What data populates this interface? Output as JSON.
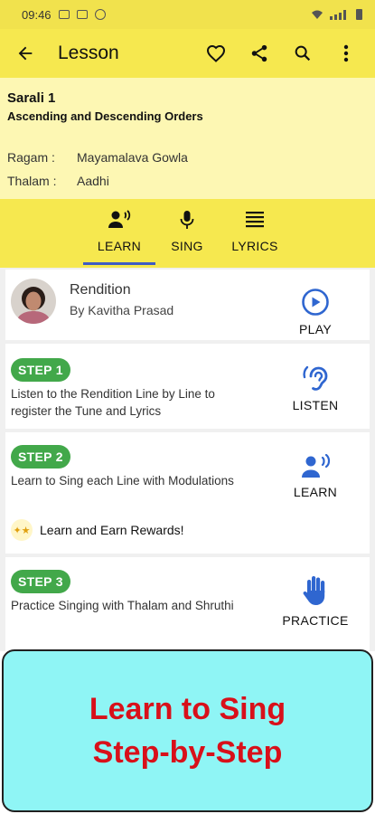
{
  "status_bar": {
    "time": "09:46"
  },
  "app_bar": {
    "title": "Lesson"
  },
  "lesson": {
    "title": "Sarali 1",
    "subtitle": "Ascending and Descending Orders",
    "ragam_label": "Ragam :",
    "ragam_value": "Mayamalava Gowla",
    "thalam_label": "Thalam :",
    "thalam_value": "Aadhi"
  },
  "tabs": [
    {
      "label": "LEARN",
      "icon": "learn-icon",
      "selected": true
    },
    {
      "label": "SING",
      "icon": "microphone-icon",
      "selected": false
    },
    {
      "label": "LYRICS",
      "icon": "lyrics-icon",
      "selected": false
    }
  ],
  "rendition": {
    "title": "Rendition",
    "subtitle": "By Kavitha Prasad",
    "action_label": "PLAY"
  },
  "steps": [
    {
      "badge": "STEP 1",
      "description": "Listen to the Rendition Line by Line to register the Tune and Lyrics",
      "action_label": "LISTEN"
    },
    {
      "badge": "STEP 2",
      "description": "Learn to Sing each Line with Modulations",
      "action_label": "LEARN",
      "rewards_text": "Learn and Earn Rewards!"
    },
    {
      "badge": "STEP 3",
      "description": "Practice Singing with Thalam and Shruthi",
      "action_label": "PRACTICE"
    }
  ],
  "banner": {
    "line1": "Learn to Sing",
    "line2": "Step-by-Step"
  },
  "colors": {
    "app_bar": "#f6e84f",
    "info_panel": "#fdf7b3",
    "accent_blue": "#2f66d0",
    "step_green": "#42a84a",
    "banner_bg": "#8ff5f5",
    "banner_text": "#d8101a"
  }
}
